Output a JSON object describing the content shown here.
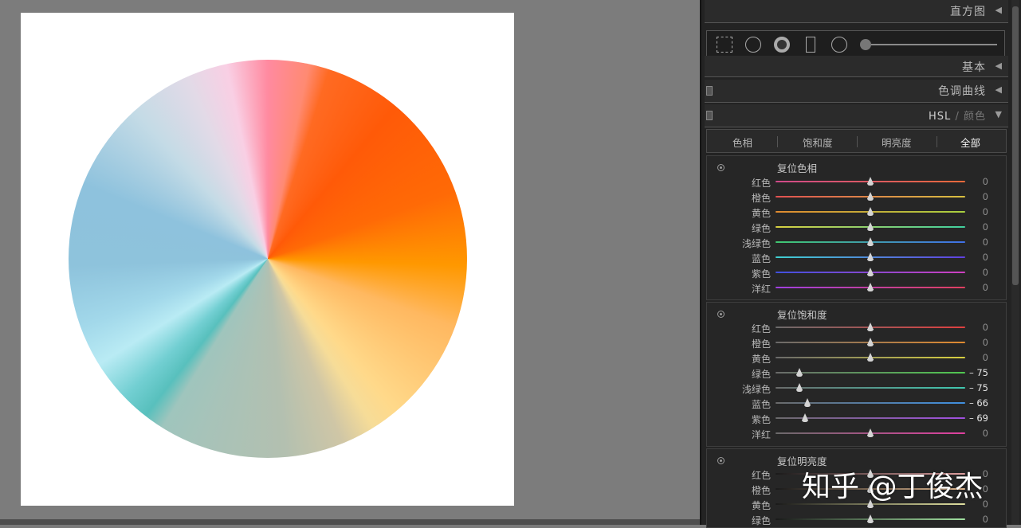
{
  "panels": {
    "histogram": "直方图",
    "basic": "基本",
    "tone_curve": "色调曲线",
    "hsl_label": "HSL",
    "hsl_sep": "/",
    "color_label": "颜色"
  },
  "tools": [
    "crop-icon",
    "spot-removal-icon",
    "red-eye-icon",
    "graduated-filter-icon",
    "radial-filter-icon",
    "brush-icon"
  ],
  "tabs": [
    {
      "label": "色相",
      "active": false
    },
    {
      "label": "饱和度",
      "active": false
    },
    {
      "label": "明亮度",
      "active": false
    },
    {
      "label": "全部",
      "active": true
    }
  ],
  "hue_section": {
    "title": "复位色相",
    "rows": [
      {
        "label": "红色",
        "value": "0",
        "pos": 0.5
      },
      {
        "label": "橙色",
        "value": "0",
        "pos": 0.5
      },
      {
        "label": "黄色",
        "value": "0",
        "pos": 0.5
      },
      {
        "label": "绿色",
        "value": "0",
        "pos": 0.5
      },
      {
        "label": "浅绿色",
        "value": "0",
        "pos": 0.5
      },
      {
        "label": "蓝色",
        "value": "0",
        "pos": 0.5
      },
      {
        "label": "紫色",
        "value": "0",
        "pos": 0.5
      },
      {
        "label": "洋红",
        "value": "0",
        "pos": 0.5
      }
    ]
  },
  "saturation_section": {
    "title": "复位饱和度",
    "rows": [
      {
        "label": "红色",
        "value": "0",
        "pos": 0.5
      },
      {
        "label": "橙色",
        "value": "0",
        "pos": 0.5
      },
      {
        "label": "黄色",
        "value": "0",
        "pos": 0.5
      },
      {
        "label": "绿色",
        "value": "– 75",
        "pos": 0.125
      },
      {
        "label": "浅绿色",
        "value": "– 75",
        "pos": 0.125
      },
      {
        "label": "蓝色",
        "value": "– 66",
        "pos": 0.17
      },
      {
        "label": "紫色",
        "value": "– 69",
        "pos": 0.155
      },
      {
        "label": "洋红",
        "value": "0",
        "pos": 0.5
      }
    ]
  },
  "luminance_section": {
    "title": "复位明亮度",
    "rows": [
      {
        "label": "红色",
        "value": "0",
        "pos": 0.5
      },
      {
        "label": "橙色",
        "value": "0",
        "pos": 0.5
      },
      {
        "label": "黄色",
        "value": "0",
        "pos": 0.5
      },
      {
        "label": "绿色",
        "value": "0",
        "pos": 0.5
      }
    ]
  },
  "watermark": "知乎 @丁俊杰",
  "colors": {
    "panel_bg": "#232323",
    "canvas_bg": "#7c7c7c",
    "hue_tracks": [
      [
        "#d04a8a",
        "#e86a3a"
      ],
      [
        "#e05050",
        "#d8c040"
      ],
      [
        "#e08a30",
        "#a8d040"
      ],
      [
        "#d8d040",
        "#40d0a0"
      ],
      [
        "#40c870",
        "#4070e8"
      ],
      [
        "#40d0d0",
        "#6040e0"
      ],
      [
        "#4050e0",
        "#d040c0"
      ],
      [
        "#a040e0",
        "#e04060"
      ]
    ],
    "sat_tracks": [
      [
        "#6a6a6a",
        "#e04040"
      ],
      [
        "#6a6a6a",
        "#e08a30"
      ],
      [
        "#6a6a6a",
        "#d8d040"
      ],
      [
        "#6a6a6a",
        "#50c850"
      ],
      [
        "#6a6a6a",
        "#40c8b0"
      ],
      [
        "#6a6a6a",
        "#4090e0"
      ],
      [
        "#6a6a6a",
        "#a050e0"
      ],
      [
        "#6a6a6a",
        "#e040a0"
      ]
    ],
    "lum_tracks": [
      [
        "#1a1a1a",
        "#e0a0a0"
      ],
      [
        "#1a1a1a",
        "#e0b890"
      ],
      [
        "#1a1a1a",
        "#e0e0a0"
      ],
      [
        "#1a1a1a",
        "#a0e0a0"
      ]
    ]
  }
}
